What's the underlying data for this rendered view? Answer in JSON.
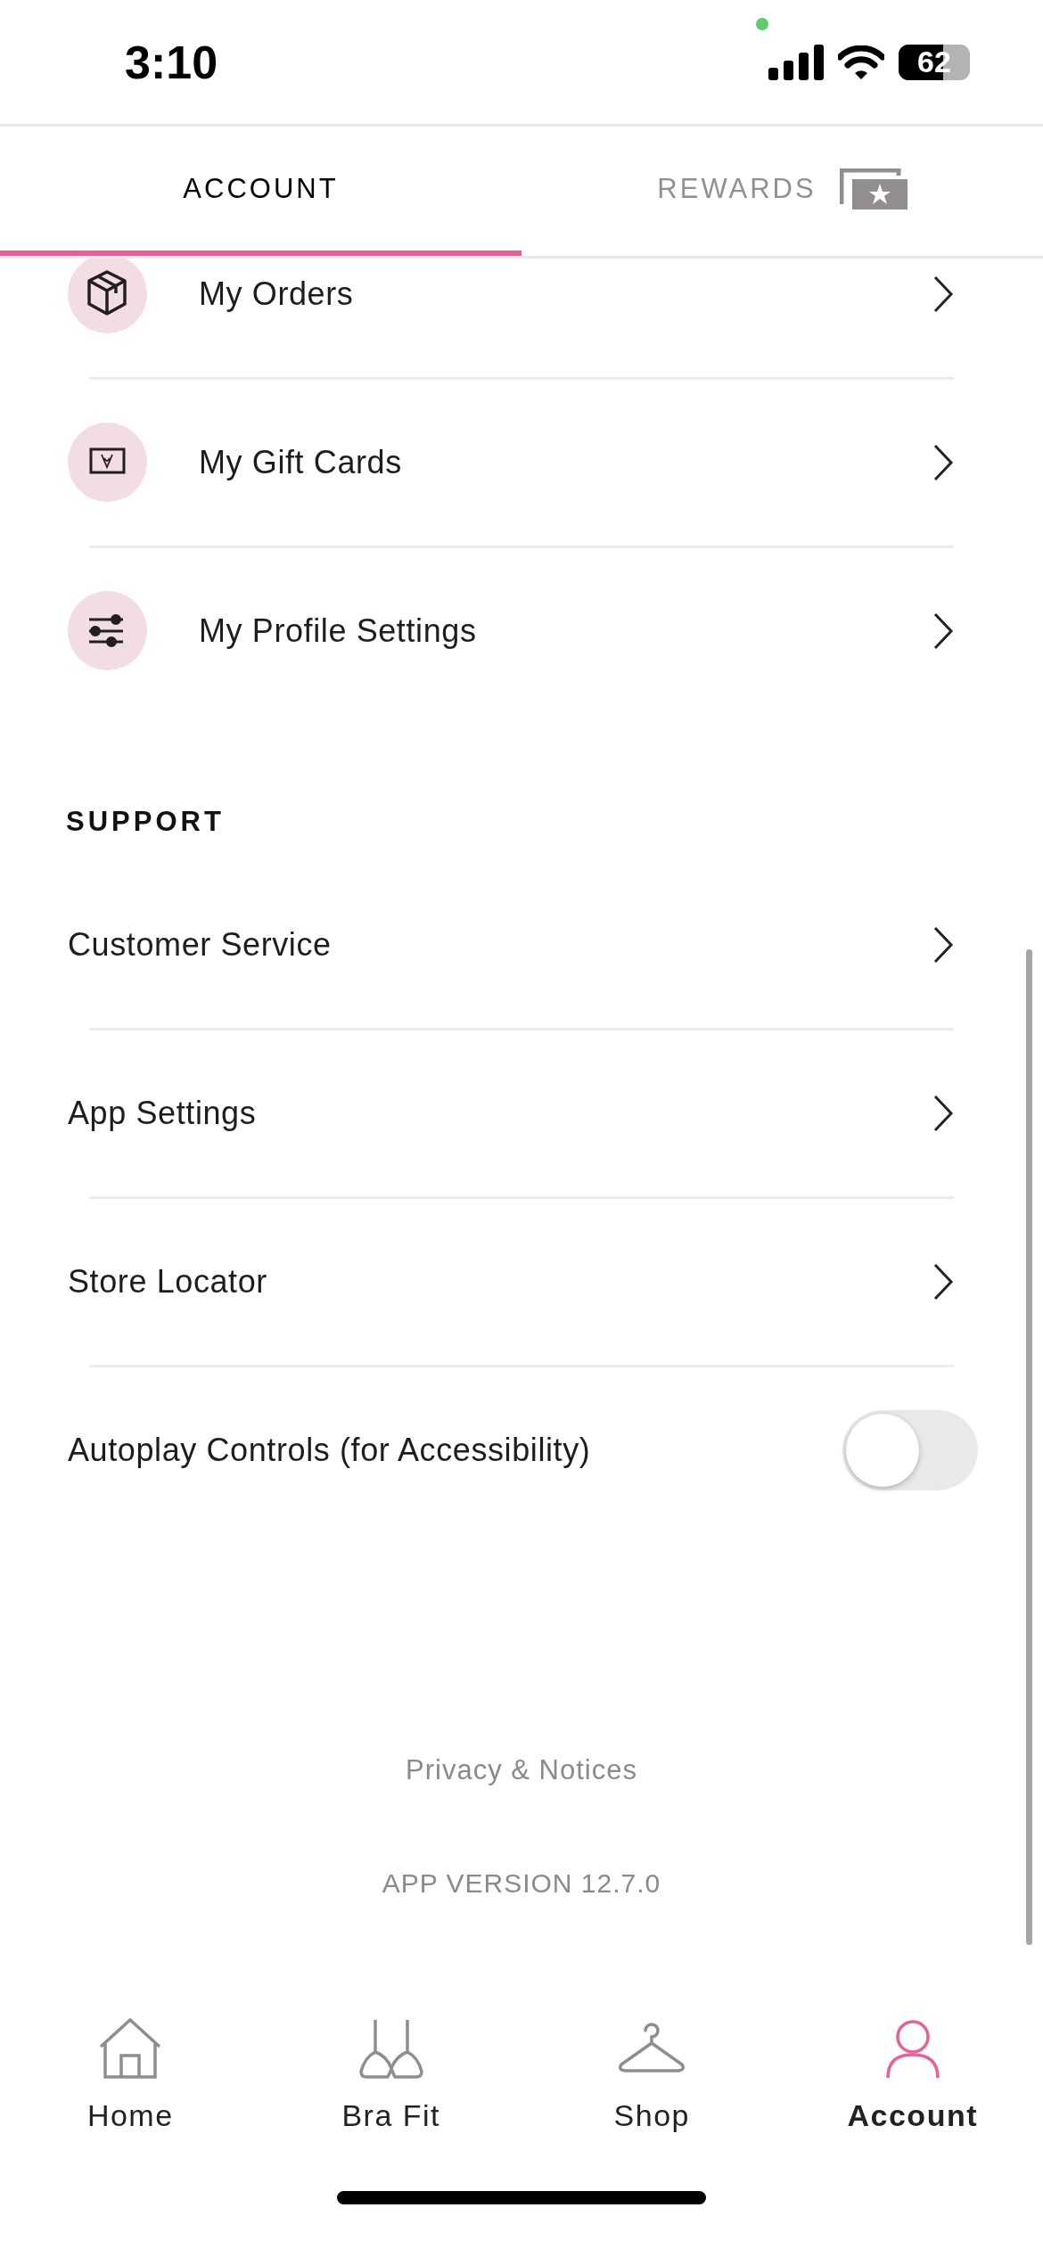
{
  "status_bar": {
    "time": "3:10",
    "battery": "62"
  },
  "tabs": [
    {
      "label": "ACCOUNT",
      "selected": true
    },
    {
      "label": "REWARDS",
      "selected": false
    }
  ],
  "account_items": [
    {
      "label": "My Orders",
      "kind": "orders"
    },
    {
      "label": "My Gift Cards",
      "kind": "giftcards"
    },
    {
      "label": "My Profile Settings",
      "kind": "profile"
    }
  ],
  "support": {
    "title": "SUPPORT",
    "items": [
      {
        "label": "Customer Service",
        "kind": "link"
      },
      {
        "label": "App Settings",
        "kind": "link"
      },
      {
        "label": "Store Locator",
        "kind": "link"
      },
      {
        "label": "Autoplay Controls (for Accessibility)",
        "kind": "toggle",
        "on": false
      }
    ]
  },
  "footer": {
    "link": "Privacy & Notices",
    "version": "APP VERSION 12.7.0"
  },
  "bottom_nav": [
    {
      "label": "Home",
      "kind": "home",
      "selected": false
    },
    {
      "label": "Bra Fit",
      "kind": "brafit",
      "selected": false
    },
    {
      "label": "Shop",
      "kind": "shop",
      "selected": false
    },
    {
      "label": "Account",
      "kind": "account",
      "selected": true
    }
  ]
}
